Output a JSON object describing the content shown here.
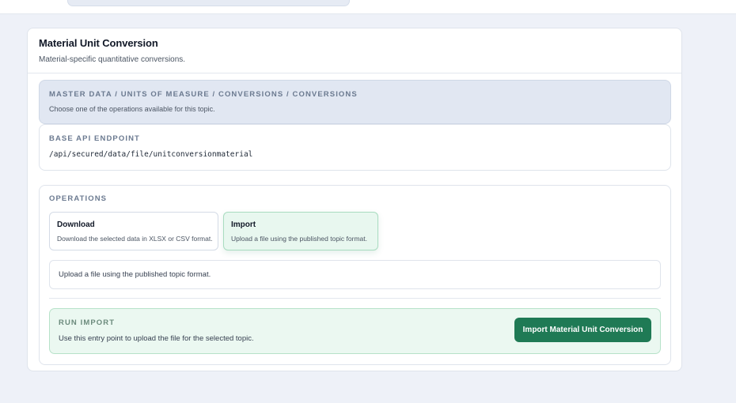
{
  "card": {
    "title": "Material Unit Conversion",
    "subtitle": "Material-specific quantitative conversions."
  },
  "breadcrumb": {
    "path": "MASTER DATA / UNITS OF MEASURE / CONVERSIONS / CONVERSIONS",
    "hint": "Choose one of the operations available for this topic."
  },
  "endpoint": {
    "label": "BASE API ENDPOINT",
    "value": "/api/secured/data/file/unitconversionmaterial"
  },
  "operations": {
    "label": "OPERATIONS",
    "items": [
      {
        "name": "Download",
        "description": "Download the selected data in XLSX or CSV format.",
        "selected": false
      },
      {
        "name": "Import",
        "description": "Upload a file using the published topic format.",
        "selected": true
      }
    ],
    "selected_note": "Upload a file using the published topic format."
  },
  "run": {
    "label": "RUN IMPORT",
    "description": "Use this entry point to upload the file for the selected topic.",
    "button_label": "Import Material Unit Conversion"
  },
  "colors": {
    "page_background": "#eef1f8",
    "accent_green": "#1f7a55",
    "selected_tile": "#e8f7ef",
    "breadcrumb_background": "#e1e7f2"
  }
}
